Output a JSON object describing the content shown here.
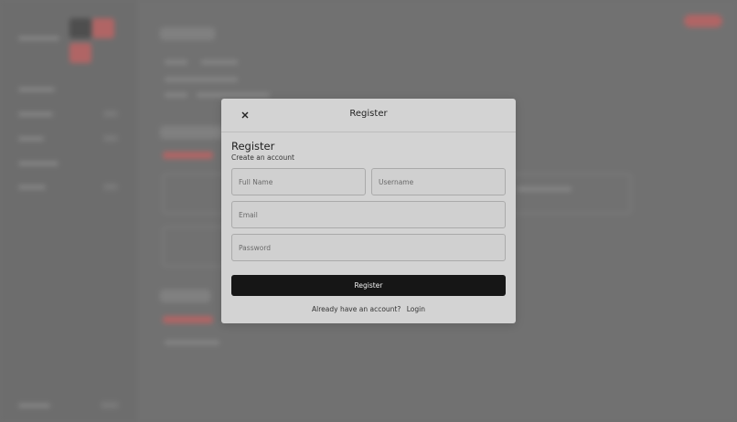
{
  "modal": {
    "title": "Register",
    "close_icon": "close-icon",
    "heading": "Register",
    "subheading": "Create an account",
    "fields": {
      "full_name": {
        "placeholder": "Full Name",
        "value": ""
      },
      "username": {
        "placeholder": "Username",
        "value": ""
      },
      "email": {
        "placeholder": "Email",
        "value": ""
      },
      "password": {
        "placeholder": "Password",
        "value": ""
      }
    },
    "submit_label": "Register",
    "footer_text": "Already have an account?",
    "login_link": "Login"
  },
  "colors": {
    "modal_bg": "#d3d3d3",
    "submit_bg": "#161616",
    "backdrop": "#6f6f6f",
    "accent_red": "#b06565"
  }
}
